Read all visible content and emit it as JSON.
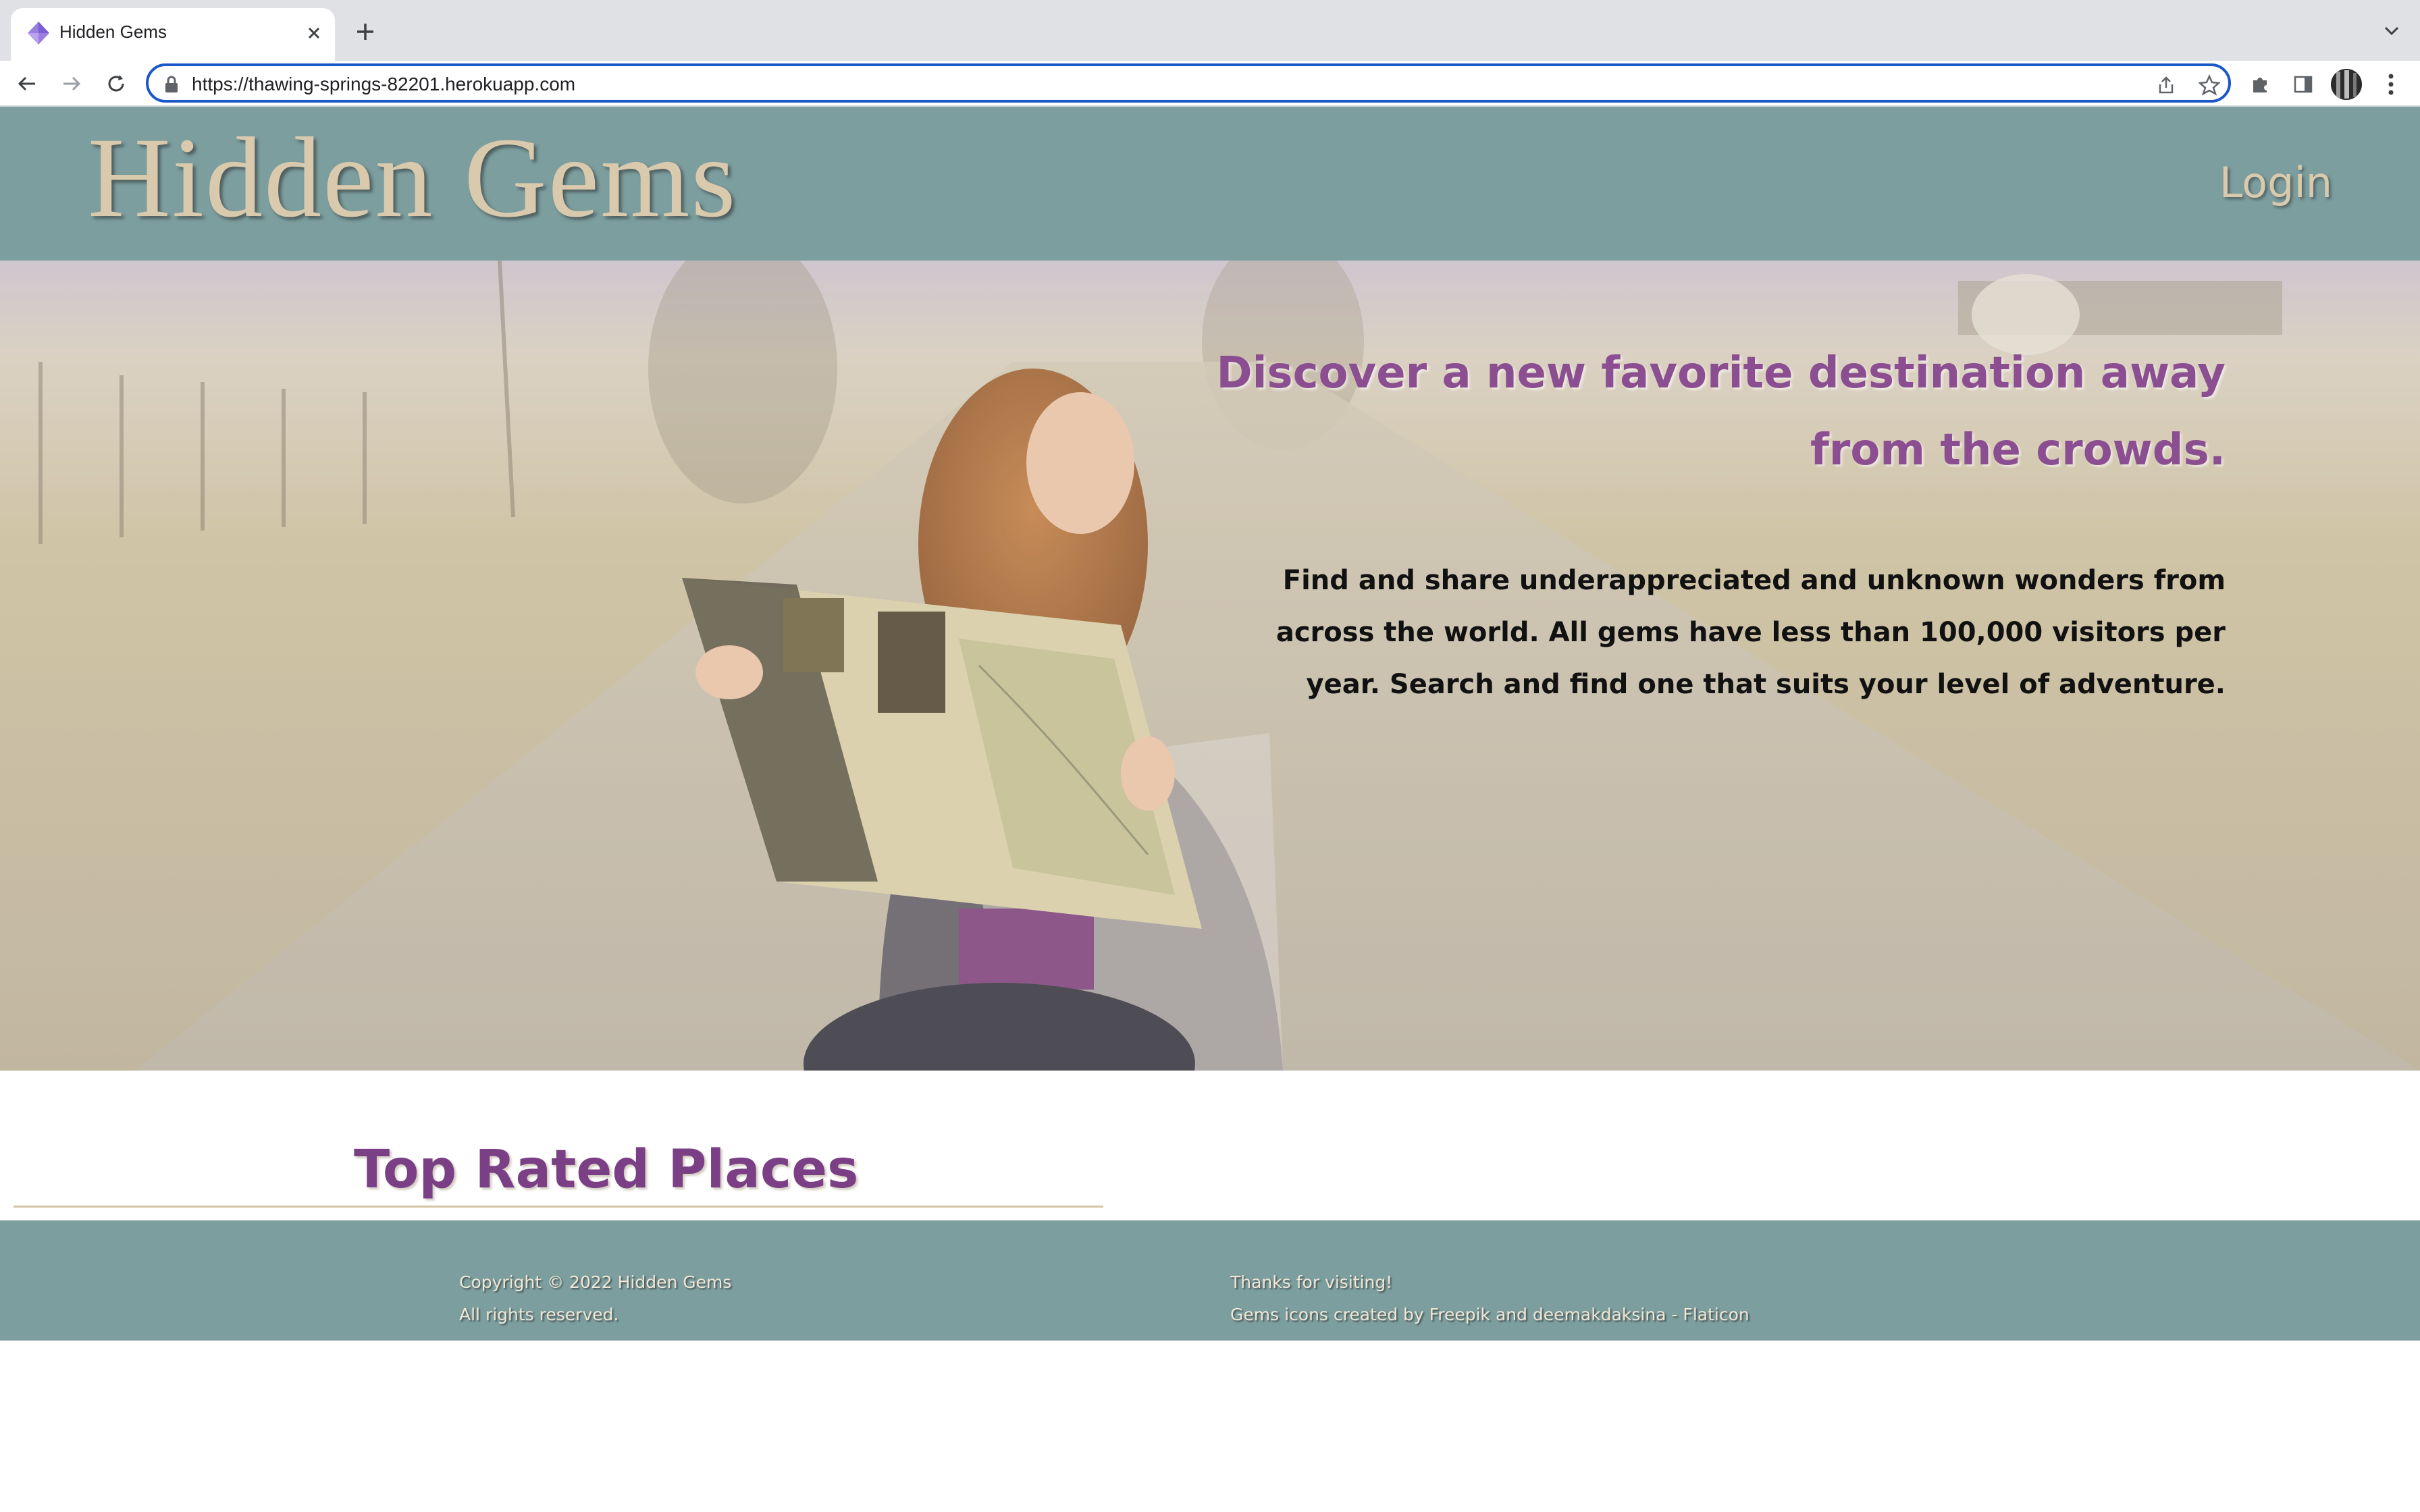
{
  "browser": {
    "tab_title": "Hidden Gems",
    "url": "https://thawing-springs-82201.herokuapp.com"
  },
  "site": {
    "title": "Hidden Gems",
    "login_label": "Login"
  },
  "hero": {
    "heading": "Discover a new favorite destination away from the crowds.",
    "description": "Find and share underappreciated and unknown wonders from across the world. All gems have less than 100,000 visitors per year. Search and find one that suits your level of adventure."
  },
  "main": {
    "section_title": "Top Rated Places"
  },
  "footer": {
    "copyright": "Copyright © 2022 Hidden Gems",
    "rights": "All rights reserved.",
    "thanks": "Thanks for visiting!",
    "credits": "Gems icons created by Freepik and deemakdaksina - Flaticon"
  },
  "colors": {
    "header_bg": "#7c9e9f",
    "title_color": "#d9c9ad",
    "accent_purple": "#8a4e91",
    "omnibox_border": "#1a57c8"
  },
  "icons": [
    "gem-favicon-icon",
    "close-icon",
    "plus-icon",
    "chevron-down-icon",
    "back-arrow-icon",
    "forward-arrow-icon",
    "reload-icon",
    "lock-icon",
    "share-icon",
    "star-icon",
    "puzzle-icon",
    "side-panel-icon",
    "kebab-menu-icon"
  ]
}
